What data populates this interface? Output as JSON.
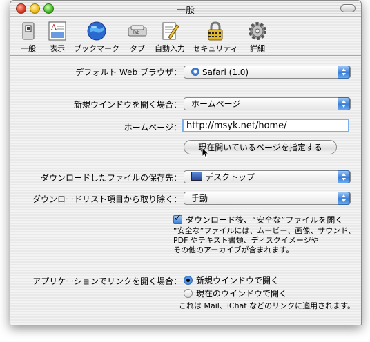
{
  "window": {
    "title": "一般"
  },
  "toolbar": {
    "items": [
      {
        "label": "一般",
        "icon": "switch-icon"
      },
      {
        "label": "表示",
        "icon": "appearance-icon"
      },
      {
        "label": "ブックマーク",
        "icon": "globe-icon"
      },
      {
        "label": "タブ",
        "icon": "tab-icon"
      },
      {
        "label": "自動入力",
        "icon": "pencil-form-icon"
      },
      {
        "label": "セキュリティ",
        "icon": "lock-icon"
      },
      {
        "label": "詳細",
        "icon": "gear-icon"
      }
    ]
  },
  "general": {
    "default_browser_label": "デフォルト Web ブラウザ：",
    "default_browser_value": "Safari (1.0)",
    "new_window_label": "新規ウインドウを開く場合：",
    "new_window_value": "ホームページ",
    "homepage_label": "ホームページ：",
    "homepage_value": "http://msyk.net/home/",
    "set_current_button": "現在開いているページを指定する",
    "download_location_label": "ダウンロードしたファイルの保存先：",
    "download_location_value": "デスクトップ",
    "remove_items_label": "ダウンロードリスト項目から取り除く：",
    "remove_items_value": "手動",
    "open_safe_label": "ダウンロード後、“安全な”ファイルを開く",
    "open_safe_note_1": "“安全な”ファイルには、ムービー、画像、サウンド、",
    "open_safe_note_2": "PDF やテキスト書類、ディスクイメージや",
    "open_safe_note_3": "その他のアーカイブが含まれます。",
    "open_links_label": "アプリケーションでリンクを開く場合：",
    "open_links_option_1": "新規ウインドウで開く",
    "open_links_option_2": "現在のウインドウで開く",
    "open_links_note": "これは Mail、iChat などのリンクに適用されます。"
  },
  "colors": {
    "accent": "#3a7fd8",
    "field_focus": "#7ab0ee"
  }
}
